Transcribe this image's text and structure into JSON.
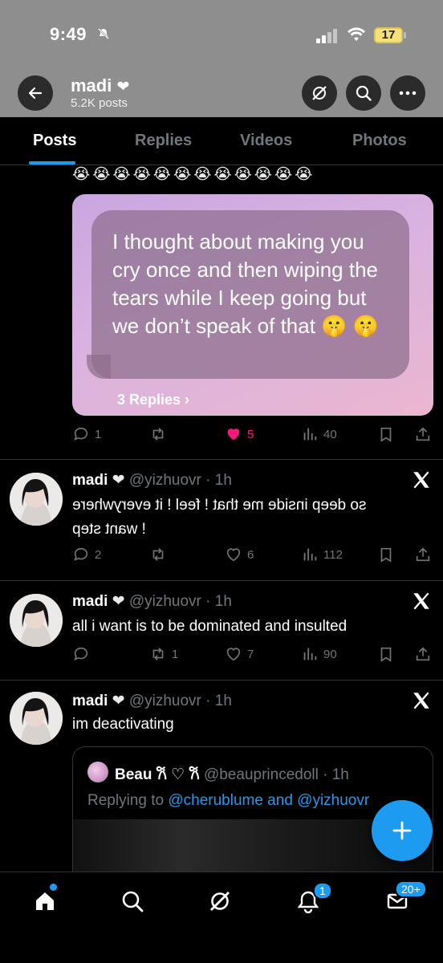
{
  "status_bar": {
    "time": "9:49",
    "battery": "17"
  },
  "header": {
    "name": "madi",
    "heart": "❤",
    "post_count": "5.2K posts"
  },
  "tabs": [
    {
      "label": "Posts",
      "active": true
    },
    {
      "label": "Replies"
    },
    {
      "label": "Videos"
    },
    {
      "label": "Photos"
    }
  ],
  "first_post": {
    "emojis": "😭😭😭😭😭😭😭😭😭😭😭😭",
    "bubble_text": "I thought about making you cry once and then wiping the tears while I keep going but we don’t speak of that  🤫 🤫",
    "replies_link": "3 Replies ›",
    "stats": {
      "replies": "1",
      "likes": "5",
      "views": "40"
    }
  },
  "tweets": [
    {
      "name": "madi",
      "heart": "❤",
      "meta": "@yizhuovr · 1h",
      "text_line1": "so deep inside me that ! feel ! it everywhere",
      "text_line2": "! want step",
      "stats": {
        "replies": "2",
        "reposts": "",
        "likes": "6",
        "views": "112"
      }
    },
    {
      "name": "madi",
      "heart": "❤",
      "meta": "@yizhuovr · 1h",
      "text_line1": "all i want is to be dominated and insulted",
      "stats": {
        "replies": "",
        "reposts": "1",
        "likes": "7",
        "views": "90"
      }
    },
    {
      "name": "madi",
      "heart": "❤",
      "meta": "@yizhuovr · 1h",
      "text_line1": "im deactivating"
    }
  ],
  "quote": {
    "name": "Beau 𐙚 ♡ 𐙚",
    "meta": "@beauprincedoll · 1h",
    "replying_prefix": "Replying to ",
    "replying_users": "@cherublume and @yizhuovr"
  },
  "bottom_nav": {
    "notifications_badge": "1",
    "messages_badge": "20+"
  },
  "colors": {
    "accent": "#1d9bf0",
    "like": "#f91880",
    "muted": "#71767b"
  }
}
